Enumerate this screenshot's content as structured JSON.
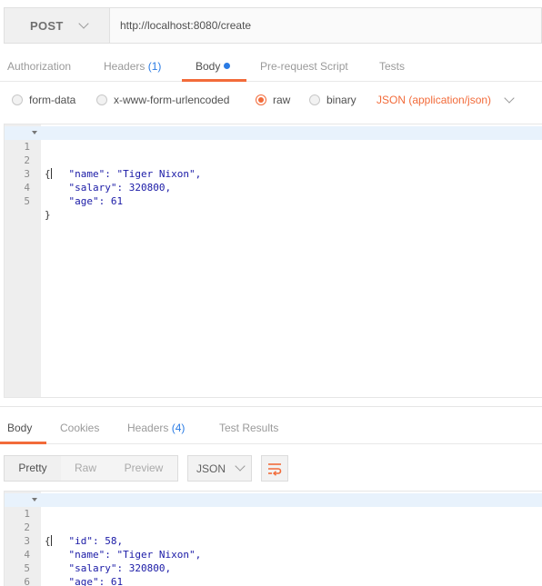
{
  "request": {
    "method": "POST",
    "url": "http://localhost:8080/create"
  },
  "request_tabs": [
    {
      "label": "Authorization"
    },
    {
      "label": "Headers",
      "badge": "(1)"
    },
    {
      "label": "Body"
    },
    {
      "label": "Pre-request Script"
    },
    {
      "label": "Tests"
    }
  ],
  "body_types": [
    {
      "label": "form-data",
      "selected": false
    },
    {
      "label": "x-www-form-urlencoded",
      "selected": false
    },
    {
      "label": "raw",
      "selected": true
    },
    {
      "label": "binary",
      "selected": false
    }
  ],
  "content_type": "JSON (application/json)",
  "request_body_lines": [
    {
      "n": "1",
      "text": "{"
    },
    {
      "n": "2",
      "text": "    \"name\": \"Tiger Nixon\","
    },
    {
      "n": "3",
      "text": "    \"salary\": 320800,"
    },
    {
      "n": "4",
      "text": "    \"age\": 61"
    },
    {
      "n": "5",
      "text": "}"
    }
  ],
  "response_tabs": [
    {
      "label": "Body"
    },
    {
      "label": "Cookies"
    },
    {
      "label": "Headers",
      "badge": "(4)"
    },
    {
      "label": "Test Results"
    }
  ],
  "response_formats": [
    "Pretty",
    "Raw",
    "Preview"
  ],
  "response_language": "JSON",
  "response_body_lines": [
    {
      "n": "1",
      "text": "{"
    },
    {
      "n": "2",
      "text": "    \"id\": 58,"
    },
    {
      "n": "3",
      "text": "    \"name\": \"Tiger Nixon\","
    },
    {
      "n": "4",
      "text": "    \"salary\": 320800,"
    },
    {
      "n": "5",
      "text": "    \"age\": 61"
    },
    {
      "n": "6",
      "text": "}"
    }
  ],
  "colors": {
    "accent": "#f26b3a",
    "badge": "#2a7be4",
    "json_token": "#1a1aa6"
  },
  "icons": {
    "method_dropdown": "chevron-down-icon",
    "content_type_dropdown": "chevron-down-icon",
    "wrap": "wrap-lines-icon"
  }
}
